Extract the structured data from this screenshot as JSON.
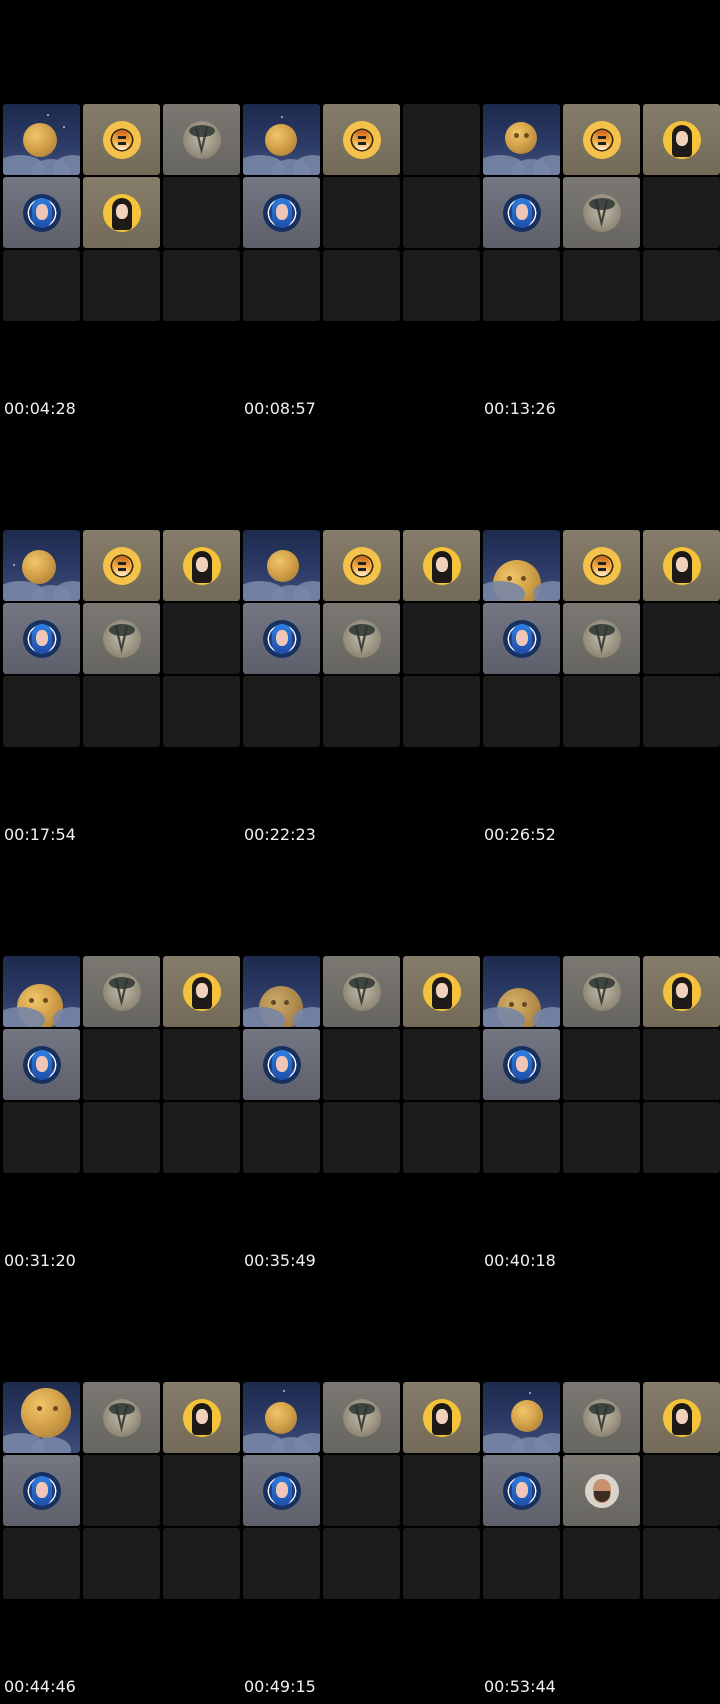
{
  "timestamps": [
    "00:04:28",
    "00:08:57",
    "00:13:26",
    "00:17:54",
    "00:22:23",
    "00:26:52",
    "00:31:20",
    "00:35:49",
    "00:40:18",
    "00:44:46",
    "00:49:15",
    "00:53:44"
  ],
  "colors": {
    "background": "#000000",
    "empty_tile": "#1c1c1c",
    "tile_brown": "#857d69",
    "tile_gray": "#7b7872",
    "timestamp_text": "#f1f1f1"
  },
  "icons": [
    "moon-video-tile",
    "tiger-avatar-icon",
    "woman-avatar-icon",
    "wolf-avatar-icon",
    "blue-hair-avatar-icon",
    "man-avatar-icon"
  ]
}
